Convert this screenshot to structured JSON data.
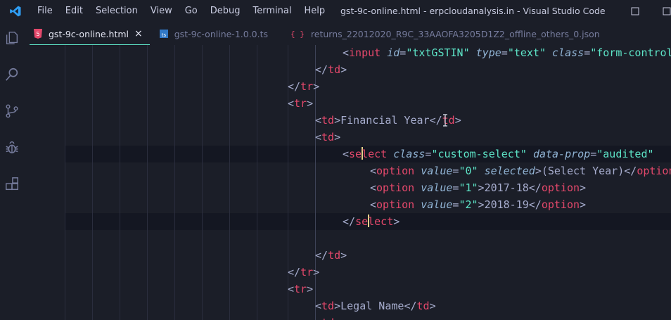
{
  "titlebar": {
    "app_icon": "vscode-logo-icon",
    "menu": [
      "File",
      "Edit",
      "Selection",
      "View",
      "Go",
      "Debug",
      "Terminal",
      "Help"
    ],
    "window_title": "gst-9c-online.html - erpcloudanalysis.in - Visual Studio Code"
  },
  "activitybar": {
    "icons": [
      "explorer-icon",
      "search-icon",
      "source-control-icon",
      "debug-icon",
      "extensions-icon"
    ]
  },
  "tabs": [
    {
      "label": "gst-9c-online.html",
      "icon": "html5-icon",
      "active": true,
      "close": "×"
    },
    {
      "label": "gst-9c-online-1.0.0.ts",
      "icon": "typescript-icon",
      "active": false
    },
    {
      "label": "returns_22012020_R9C_33AAOFA3205D1Z2_offline_others_0.json",
      "icon": "json-braces-icon",
      "active": false
    }
  ],
  "code_lines": [
    {
      "indent": 3,
      "parts": [
        [
          "br",
          "<"
        ],
        [
          "tag",
          "input"
        ],
        [
          "sp",
          " "
        ],
        [
          "attr",
          "id"
        ],
        [
          "eq",
          "="
        ],
        [
          "str",
          "\"txtGSTIN\""
        ],
        [
          "sp",
          " "
        ],
        [
          "attr",
          "type"
        ],
        [
          "eq",
          "="
        ],
        [
          "str",
          "\"text\""
        ],
        [
          "sp",
          " "
        ],
        [
          "attr",
          "class"
        ],
        [
          "eq",
          "="
        ],
        [
          "str",
          "\"form-control\""
        ]
      ]
    },
    {
      "indent": 2,
      "parts": [
        [
          "br",
          "</"
        ],
        [
          "tag",
          "td"
        ],
        [
          "br",
          ">"
        ]
      ]
    },
    {
      "indent": 1,
      "parts": [
        [
          "br",
          "</"
        ],
        [
          "tag",
          "tr"
        ],
        [
          "br",
          ">"
        ]
      ]
    },
    {
      "indent": 1,
      "parts": [
        [
          "br",
          "<"
        ],
        [
          "tag",
          "tr"
        ],
        [
          "br",
          ">"
        ]
      ]
    },
    {
      "indent": 2,
      "parts": [
        [
          "br",
          "<"
        ],
        [
          "tag",
          "td"
        ],
        [
          "br",
          ">"
        ],
        [
          "txt",
          "Financial Year"
        ],
        [
          "br",
          "</"
        ],
        [
          "tag",
          "td"
        ],
        [
          "br",
          ">"
        ]
      ]
    },
    {
      "indent": 2,
      "parts": [
        [
          "br",
          "<"
        ],
        [
          "tag",
          "td"
        ],
        [
          "br",
          ">"
        ]
      ]
    },
    {
      "indent": 3,
      "parts": [
        [
          "br",
          "<"
        ],
        [
          "tag",
          "se"
        ],
        [
          "caret",
          ""
        ],
        [
          "tag",
          "lect"
        ],
        [
          "sp",
          " "
        ],
        [
          "attr",
          "class"
        ],
        [
          "eq",
          "="
        ],
        [
          "str",
          "\"custom-select\""
        ],
        [
          "sp",
          " "
        ],
        [
          "attr",
          "data-prop"
        ],
        [
          "eq",
          "="
        ],
        [
          "str",
          "\"audited\""
        ]
      ]
    },
    {
      "indent": 4,
      "parts": [
        [
          "br",
          "<"
        ],
        [
          "tag",
          "option"
        ],
        [
          "sp",
          " "
        ],
        [
          "attr",
          "value"
        ],
        [
          "eq",
          "="
        ],
        [
          "str",
          "\"0\""
        ],
        [
          "sp",
          " "
        ],
        [
          "attr",
          "selected"
        ],
        [
          "br",
          ">"
        ],
        [
          "txt",
          "(Select Year)"
        ],
        [
          "br",
          "</"
        ],
        [
          "tag",
          "option"
        ],
        [
          "br",
          ">"
        ]
      ]
    },
    {
      "indent": 4,
      "parts": [
        [
          "br",
          "<"
        ],
        [
          "tag",
          "option"
        ],
        [
          "sp",
          " "
        ],
        [
          "attr",
          "value"
        ],
        [
          "eq",
          "="
        ],
        [
          "str",
          "\"1\""
        ],
        [
          "br",
          ">"
        ],
        [
          "txt",
          "2017-18"
        ],
        [
          "br",
          "</"
        ],
        [
          "tag",
          "option"
        ],
        [
          "br",
          ">"
        ]
      ]
    },
    {
      "indent": 4,
      "parts": [
        [
          "br",
          "<"
        ],
        [
          "tag",
          "option"
        ],
        [
          "sp",
          " "
        ],
        [
          "attr",
          "value"
        ],
        [
          "eq",
          "="
        ],
        [
          "str",
          "\"2\""
        ],
        [
          "br",
          ">"
        ],
        [
          "txt",
          "2018-19"
        ],
        [
          "br",
          "</"
        ],
        [
          "tag",
          "option"
        ],
        [
          "br",
          ">"
        ]
      ]
    },
    {
      "indent": 3,
      "parts": [
        [
          "br",
          "</"
        ],
        [
          "tag",
          "se"
        ],
        [
          "caret",
          ""
        ],
        [
          "tag",
          "lect"
        ],
        [
          "br",
          ">"
        ]
      ]
    },
    {
      "indent": 0,
      "parts": []
    },
    {
      "indent": 2,
      "parts": [
        [
          "br",
          "</"
        ],
        [
          "tag",
          "td"
        ],
        [
          "br",
          ">"
        ]
      ]
    },
    {
      "indent": 1,
      "parts": [
        [
          "br",
          "</"
        ],
        [
          "tag",
          "tr"
        ],
        [
          "br",
          ">"
        ]
      ]
    },
    {
      "indent": 1,
      "parts": [
        [
          "br",
          "<"
        ],
        [
          "tag",
          "tr"
        ],
        [
          "br",
          ">"
        ]
      ]
    },
    {
      "indent": 2,
      "parts": [
        [
          "br",
          "<"
        ],
        [
          "tag",
          "td"
        ],
        [
          "br",
          ">"
        ],
        [
          "txt",
          "Legal Name"
        ],
        [
          "br",
          "</"
        ],
        [
          "tag",
          "td"
        ],
        [
          "br",
          ">"
        ]
      ]
    },
    {
      "indent": 2,
      "parts": [
        [
          "br",
          "<"
        ],
        [
          "tag",
          "td"
        ],
        [
          "br",
          ">"
        ]
      ]
    }
  ],
  "colors": {
    "background": "#1b1e28",
    "tag": "#e4486b",
    "attribute": "#91b4d5",
    "string": "#5de4c7",
    "text": "#a6accd",
    "active_tab_border": "#5de4c7"
  }
}
